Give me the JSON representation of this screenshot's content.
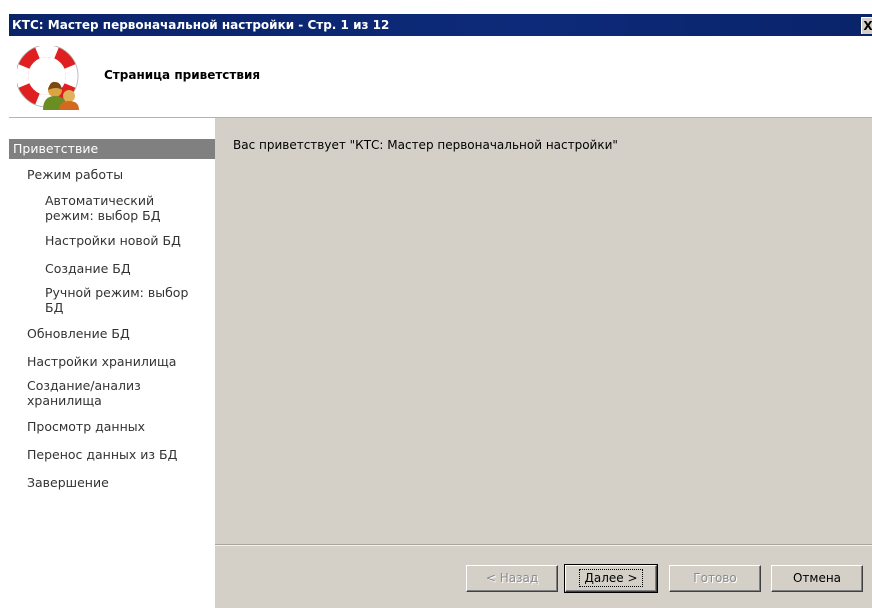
{
  "window": {
    "title": "КТС: Мастер первоначальной настройки - Стр. 1 из 12",
    "close_glyph": "X"
  },
  "header": {
    "logo_icon": "lifebuoy-users-icon",
    "page_title": "Страница приветствия"
  },
  "sidebar": {
    "items": [
      {
        "label": "Приветствие",
        "active": true
      },
      {
        "label": "Режим работы"
      },
      {
        "label": "Автоматический режим: выбор БД"
      },
      {
        "label": "Настройки новой БД"
      },
      {
        "label": "Создание БД"
      },
      {
        "label": "Ручной режим: выбор БД"
      },
      {
        "label": "Обновление БД"
      },
      {
        "label": "Настройки хранилища"
      },
      {
        "label": "Создание/анализ хранилища"
      },
      {
        "label": "Просмотр данных"
      },
      {
        "label": "Перенос данных из БД"
      },
      {
        "label": "Завершение"
      }
    ]
  },
  "main": {
    "welcome_text": "Вас приветствует \"КТС: Мастер первоначальной настройки\""
  },
  "buttons": {
    "back": "< Назад",
    "next": "Далее >",
    "finish": "Готово",
    "cancel": "Отмена"
  },
  "colors": {
    "titlebar": "#0a246a",
    "panel": "#d4d0c8",
    "active_item": "#808080"
  }
}
